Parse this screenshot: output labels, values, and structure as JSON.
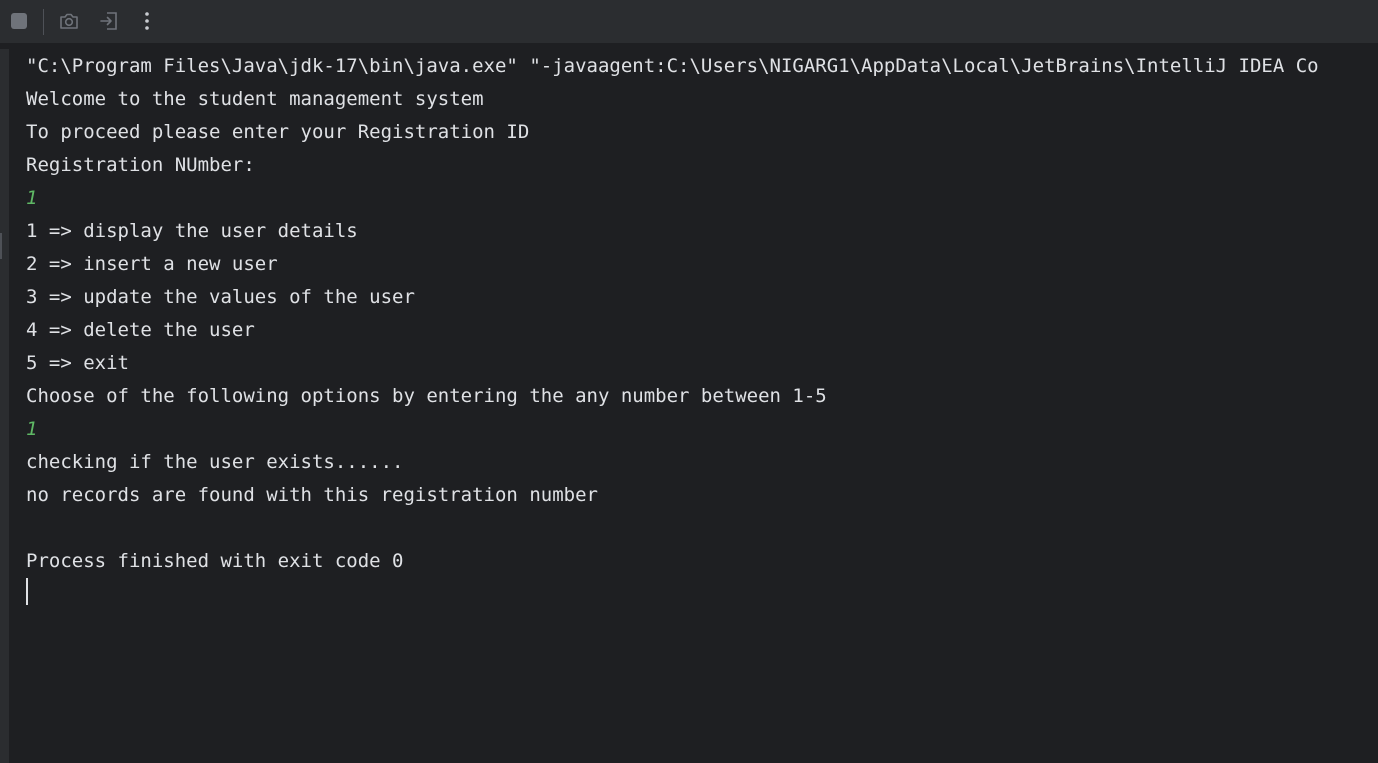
{
  "toolbar": {
    "buttons": [
      {
        "name": "stop",
        "icon": "stop-icon",
        "enabled": false
      },
      {
        "name": "screenshot",
        "icon": "camera-icon",
        "enabled": false
      },
      {
        "name": "exit",
        "icon": "exit-icon",
        "enabled": false
      },
      {
        "name": "more",
        "icon": "more-vertical-icon",
        "enabled": true
      }
    ]
  },
  "colors": {
    "background": "#1e1f22",
    "toolbar": "#2b2d30",
    "text": "#dfe1e5",
    "user_input": "#5fb865",
    "disabled_icon": "#6f737a"
  },
  "console": {
    "lines": [
      {
        "text": "\"C:\\Program Files\\Java\\jdk-17\\bin\\java.exe\" \"-javaagent:C:\\Users\\NIGARG1\\AppData\\Local\\JetBrains\\IntelliJ IDEA Co",
        "kind": "output"
      },
      {
        "text": "Welcome to the student management system",
        "kind": "output"
      },
      {
        "text": "To proceed please enter your Registration ID",
        "kind": "output"
      },
      {
        "text": "Registration NUmber:",
        "kind": "output"
      },
      {
        "text": "1",
        "kind": "input"
      },
      {
        "text": "1 => display the user details",
        "kind": "output"
      },
      {
        "text": "2 => insert a new user",
        "kind": "output"
      },
      {
        "text": "3 => update the values of the user",
        "kind": "output"
      },
      {
        "text": "4 => delete the user",
        "kind": "output"
      },
      {
        "text": "5 => exit",
        "kind": "output"
      },
      {
        "text": "Choose of the following options by entering the any number between 1-5",
        "kind": "output"
      },
      {
        "text": "1",
        "kind": "input"
      },
      {
        "text": "checking if the user exists......",
        "kind": "output"
      },
      {
        "text": "no records are found with this registration number",
        "kind": "output"
      },
      {
        "text": "",
        "kind": "output"
      },
      {
        "text": "Process finished with exit code 0",
        "kind": "output"
      }
    ]
  }
}
